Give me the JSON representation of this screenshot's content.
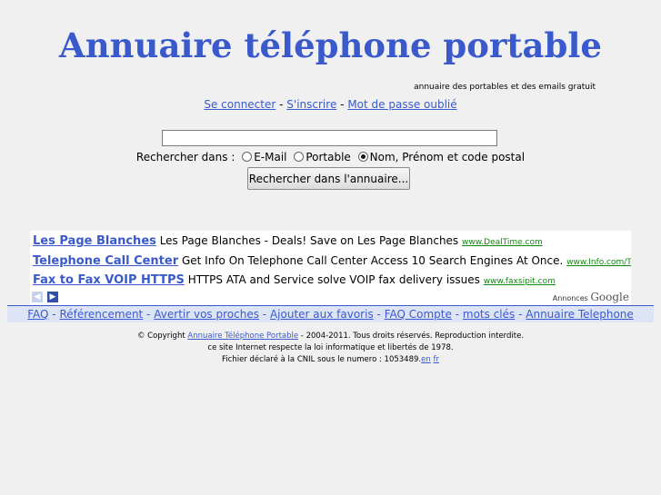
{
  "header": {
    "title": "Annuaire téléphone portable",
    "subtitle": "annuaire des portables et des emails gratuit"
  },
  "auth": {
    "login": "Se connecter",
    "register": "S'inscrire",
    "forgot": "Mot de passe oublié",
    "sep": "-"
  },
  "search": {
    "query_value": "",
    "label": "Rechercher dans :",
    "options": [
      "E-Mail",
      "Portable",
      "Nom, Prénom et code postal"
    ],
    "selected_index": 2,
    "button": "Rechercher dans l'annuaire..."
  },
  "ads": {
    "items": [
      {
        "title": "Les Page Blanches",
        "text": "Les Page Blanches - Deals! Save on Les Page Blanches",
        "url": "www.DealTime.com"
      },
      {
        "title": "Telephone Call Center",
        "text": "Get Info On Telephone Call Center Access 10 Search Engines At Once.",
        "url": "www.Info.com/Telepho"
      },
      {
        "title": "Fax to Fax VOIP HTTPS",
        "text": "HTTPS ATA and Service solve VOIP fax delivery issues",
        "url": "www.faxsipit.com"
      }
    ],
    "annonces_label": "Annonces",
    "google_label": "Google"
  },
  "footer_links": [
    "FAQ",
    "Référencement",
    "Avertir vos proches",
    "Ajouter aux favoris",
    "FAQ Compte",
    "mots clés",
    "Annuaire Telephone"
  ],
  "copyright": {
    "prefix": "© Copyright",
    "link": "Annuaire Téléphone Portable",
    "suffix": "- 2004-2011. Tous droits réservés. Reproduction interdite.",
    "line2": "ce site Internet respecte la loi informatique et libertés de 1978.",
    "line3": "Fichier déclaré à la CNIL sous le numero : 1053489.",
    "lang_en": "en",
    "lang_fr": "fr"
  },
  "colors": {
    "brand": "#3a5acb",
    "ad_url": "#118a11",
    "footer_bar": "#dde4f6",
    "background": "#f0f0f0"
  }
}
